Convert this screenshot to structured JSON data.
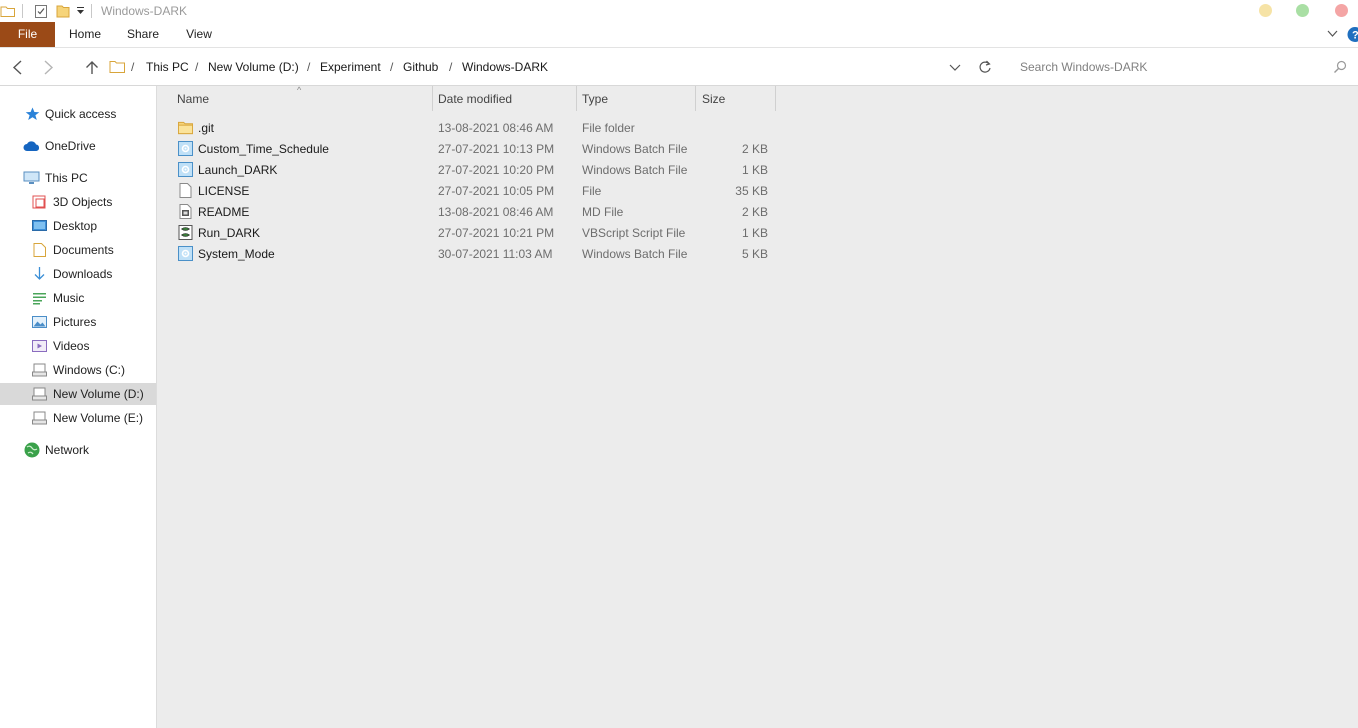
{
  "window": {
    "title": "Windows-DARK"
  },
  "ribbon": {
    "tabs": [
      "File",
      "Home",
      "Share",
      "View"
    ]
  },
  "address": {
    "breadcrumbs": [
      "This PC",
      "New Volume (D:)",
      "Experiment",
      "Github",
      "Windows-DARK"
    ],
    "search_placeholder": "Search Windows-DARK"
  },
  "sidebar": {
    "items": [
      {
        "label": "Quick access",
        "icon": "star-icon"
      },
      {
        "label": "OneDrive",
        "icon": "cloud-icon"
      },
      {
        "label": "This PC",
        "icon": "computer-icon"
      },
      {
        "label": "3D Objects",
        "icon": "cube-icon"
      },
      {
        "label": "Desktop",
        "icon": "desktop-icon"
      },
      {
        "label": "Documents",
        "icon": "document-icon"
      },
      {
        "label": "Downloads",
        "icon": "download-icon"
      },
      {
        "label": "Music",
        "icon": "music-icon"
      },
      {
        "label": "Pictures",
        "icon": "pictures-icon"
      },
      {
        "label": "Videos",
        "icon": "video-icon"
      },
      {
        "label": "Windows (C:)",
        "icon": "drive-icon"
      },
      {
        "label": "New Volume (D:)",
        "icon": "drive-icon",
        "selected": true
      },
      {
        "label": "New Volume (E:)",
        "icon": "drive-icon"
      },
      {
        "label": "Network",
        "icon": "network-icon"
      }
    ]
  },
  "filelist": {
    "columns": [
      "Name",
      "Date modified",
      "Type",
      "Size"
    ],
    "rows": [
      {
        "name": ".git",
        "date": "13-08-2021 08:46 AM",
        "type": "File folder",
        "size": "",
        "icon": "folder-icon"
      },
      {
        "name": "Custom_Time_Schedule",
        "date": "27-07-2021 10:13 PM",
        "type": "Windows Batch File",
        "size": "2 KB",
        "icon": "batch-file-icon"
      },
      {
        "name": "Launch_DARK",
        "date": "27-07-2021 10:20 PM",
        "type": "Windows Batch File",
        "size": "1 KB",
        "icon": "batch-file-icon"
      },
      {
        "name": "LICENSE",
        "date": "27-07-2021 10:05 PM",
        "type": "File",
        "size": "35 KB",
        "icon": "file-icon"
      },
      {
        "name": "README",
        "date": "13-08-2021 08:46 AM",
        "type": "MD File",
        "size": "2 KB",
        "icon": "md-file-icon"
      },
      {
        "name": "Run_DARK",
        "date": "27-07-2021 10:21 PM",
        "type": "VBScript Script File",
        "size": "1 KB",
        "icon": "vbscript-file-icon"
      },
      {
        "name": "System_Mode",
        "date": "30-07-2021 11:03 AM",
        "type": "Windows Batch File",
        "size": "5 KB",
        "icon": "batch-file-icon"
      }
    ]
  },
  "colors": {
    "file_tab": "#9b4a17",
    "minimize": "#f6e3a6",
    "maximize": "#a9dfa4",
    "close": "#f4a5a5",
    "selection": "#d9d9d9"
  }
}
